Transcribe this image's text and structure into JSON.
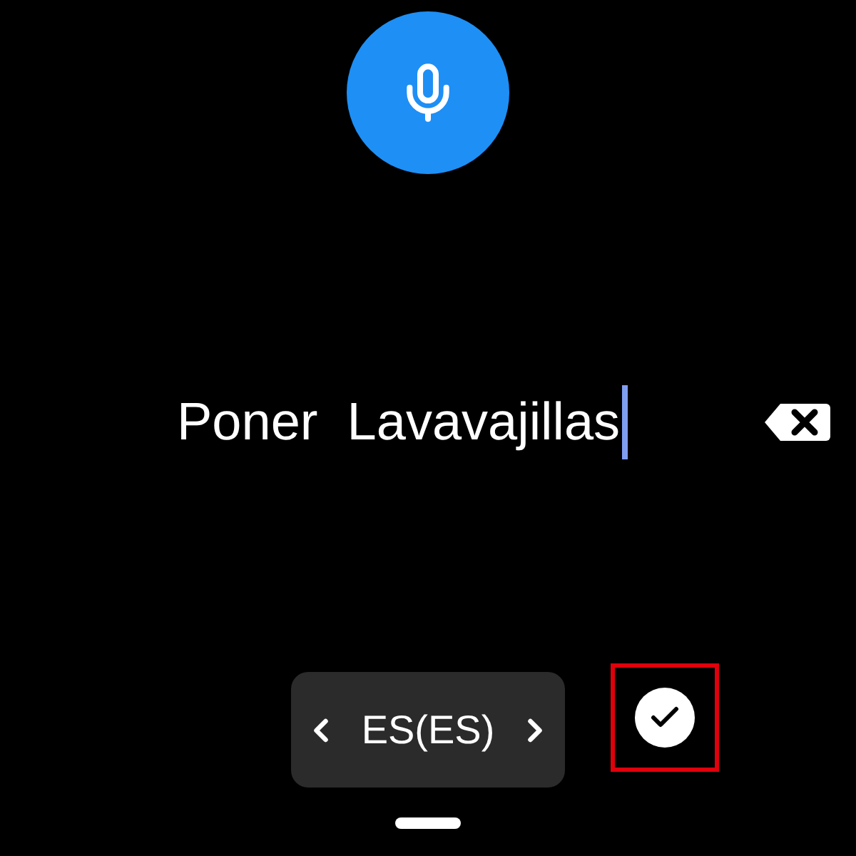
{
  "dictation": {
    "text": "Poner  Lavavajillas"
  },
  "language": {
    "label": "ES(ES)"
  },
  "confirm": {
    "highlighted": true
  }
}
